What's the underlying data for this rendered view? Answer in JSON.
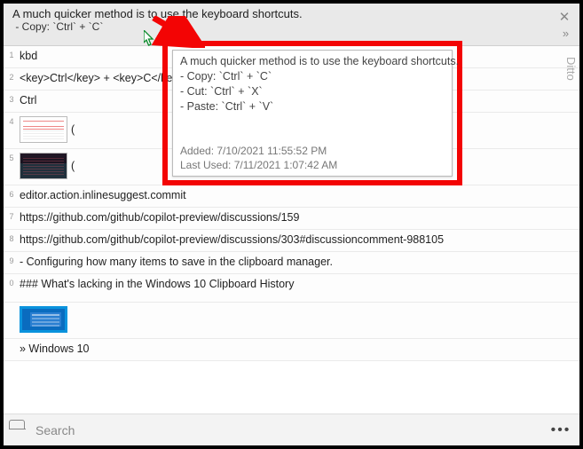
{
  "app_name": "Ditto",
  "header": {
    "line1": "A much quicker method is to use the keyboard shortcuts.",
    "line2": " - Copy: `Ctrl` + `C`"
  },
  "items": [
    {
      "idx": "1",
      "text": "kbd"
    },
    {
      "idx": "2",
      "text": "<key>Ctrl</key> + <key>C</key>"
    },
    {
      "idx": "3",
      "text": "Ctrl"
    },
    {
      "idx": "4",
      "thumb": "white",
      "text": "("
    },
    {
      "idx": "5",
      "thumb": "dark",
      "text": "("
    },
    {
      "idx": "6",
      "text": "editor.action.inlinesuggest.commit"
    },
    {
      "idx": "7",
      "text": "https://github.com/github/copilot-preview/discussions/159"
    },
    {
      "idx": "8",
      "text": "https://github.com/github/copilot-preview/discussions/303#discussioncomment-988105"
    },
    {
      "idx": "9",
      "text": "- Configuring how many items to save in the clipboard manager."
    },
    {
      "idx": "0",
      "text": "### What's lacking in the Windows 10 Clipboard History"
    },
    {
      "idx": "",
      "thumb": "blue",
      "text": ""
    },
    {
      "idx": "",
      "text": "» Windows 10"
    }
  ],
  "popover": {
    "line1": "A much quicker method is to use the keyboard shortcuts.",
    "line2": "- Copy: `Ctrl` + `C`",
    "line3": "- Cut: `Ctrl` + `X`",
    "line4": "- Paste: `Ctrl` + `V`",
    "added": "Added: 7/10/2021 11:55:52 PM",
    "last_used": "Last Used: 7/11/2021 1:07:42 AM"
  },
  "search": {
    "placeholder": "Search"
  },
  "colors": {
    "highlight_border": "#f30404"
  }
}
